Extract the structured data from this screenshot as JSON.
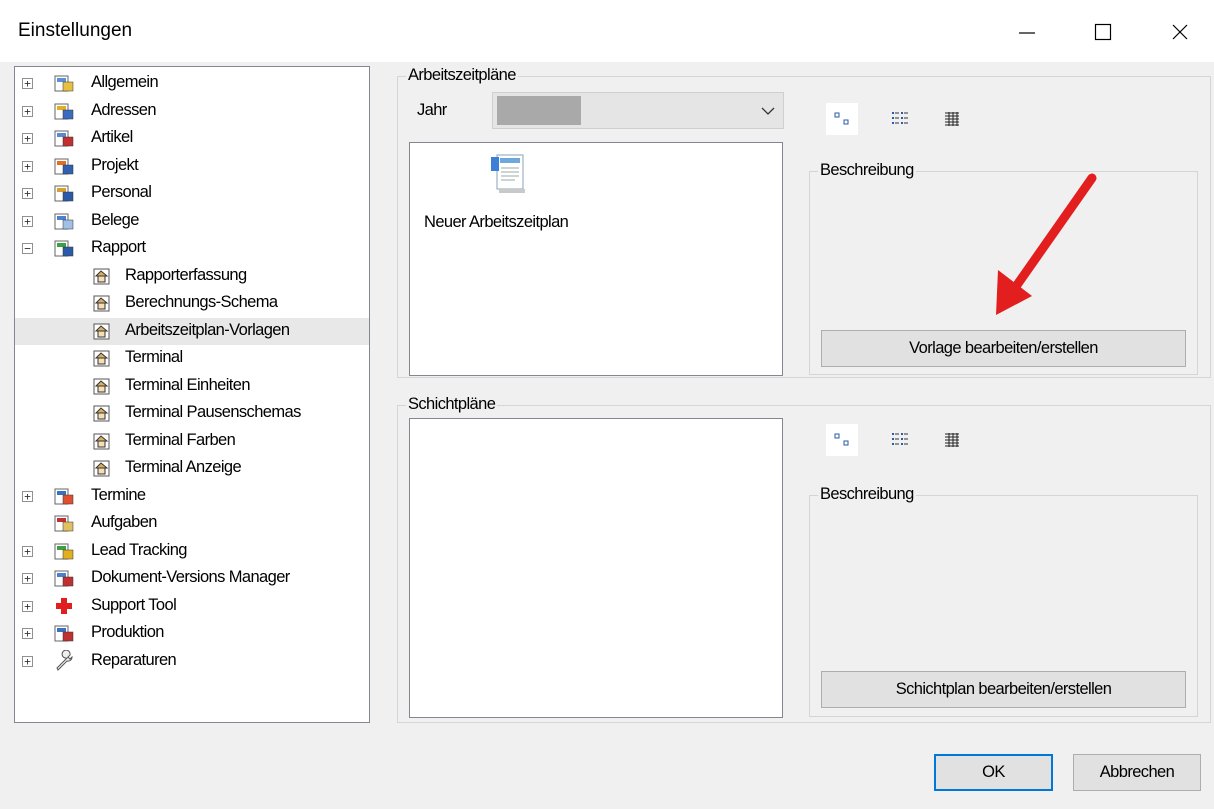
{
  "window": {
    "title": "Einstellungen",
    "minimize_glyph": "—",
    "maximize_glyph": "☐",
    "close_glyph": "✕"
  },
  "tree": {
    "items": [
      {
        "label": "Allgemein",
        "icon": "settings-edit-icon",
        "expander": "+",
        "level": 0
      },
      {
        "label": "Adressen",
        "icon": "address-book-icon",
        "expander": "+",
        "level": 0
      },
      {
        "label": "Artikel",
        "icon": "article-icon",
        "expander": "+",
        "level": 0
      },
      {
        "label": "Projekt",
        "icon": "project-icon",
        "expander": "+",
        "level": 0
      },
      {
        "label": "Personal",
        "icon": "personnel-icon",
        "expander": "+",
        "level": 0
      },
      {
        "label": "Belege",
        "icon": "documents-icon",
        "expander": "+",
        "level": 0
      },
      {
        "label": "Rapport",
        "icon": "report-icon",
        "expander": "−",
        "level": 0
      },
      {
        "label": "Rapporterfassung",
        "icon": "property-page-icon",
        "expander": "",
        "level": 1
      },
      {
        "label": "Berechnungs-Schema",
        "icon": "property-page-icon",
        "expander": "",
        "level": 1
      },
      {
        "label": "Arbeitszeitplan-Vorlagen",
        "icon": "property-page-icon",
        "expander": "",
        "level": 1,
        "selected": true
      },
      {
        "label": "Terminal",
        "icon": "property-page-icon",
        "expander": "",
        "level": 1
      },
      {
        "label": "Terminal Einheiten",
        "icon": "property-page-icon",
        "expander": "",
        "level": 1
      },
      {
        "label": "Terminal Pausenschemas",
        "icon": "property-page-icon",
        "expander": "",
        "level": 1
      },
      {
        "label": "Terminal Farben",
        "icon": "property-page-icon",
        "expander": "",
        "level": 1
      },
      {
        "label": "Terminal Anzeige",
        "icon": "property-page-icon",
        "expander": "",
        "level": 1
      },
      {
        "label": "Termine",
        "icon": "calendar-icon",
        "expander": "+",
        "level": 0
      },
      {
        "label": "Aufgaben",
        "icon": "tasks-icon",
        "expander": "",
        "level": 0
      },
      {
        "label": "Lead Tracking",
        "icon": "lead-tracking-icon",
        "expander": "+",
        "level": 0
      },
      {
        "label": "Dokument-Versions Manager",
        "icon": "document-version-icon",
        "expander": "+",
        "level": 0
      },
      {
        "label": "Support Tool",
        "icon": "support-cross-icon",
        "expander": "+",
        "level": 0
      },
      {
        "label": "Produktion",
        "icon": "production-icon",
        "expander": "+",
        "level": 0
      },
      {
        "label": "Reparaturen",
        "icon": "wrench-icon",
        "expander": "+",
        "level": 0
      }
    ]
  },
  "arbeitszeit": {
    "legend": "Arbeitszeitpläne",
    "year_label": "Jahr",
    "year_value": "",
    "list_items": [
      {
        "label": "Neuer Arbeitszeitplan",
        "icon": "new-schedule-icon"
      }
    ],
    "description_legend": "Beschreibung",
    "edit_button": "Vorlage bearbeiten/erstellen"
  },
  "schicht": {
    "legend": "Schichtpläne",
    "description_legend": "Beschreibung",
    "edit_button": "Schichtplan bearbeiten/erstellen"
  },
  "footer": {
    "ok": "OK",
    "cancel": "Abbrechen"
  },
  "colors": {
    "annotation_arrow": "#e31e1e",
    "default_button_border": "#0078d7"
  }
}
